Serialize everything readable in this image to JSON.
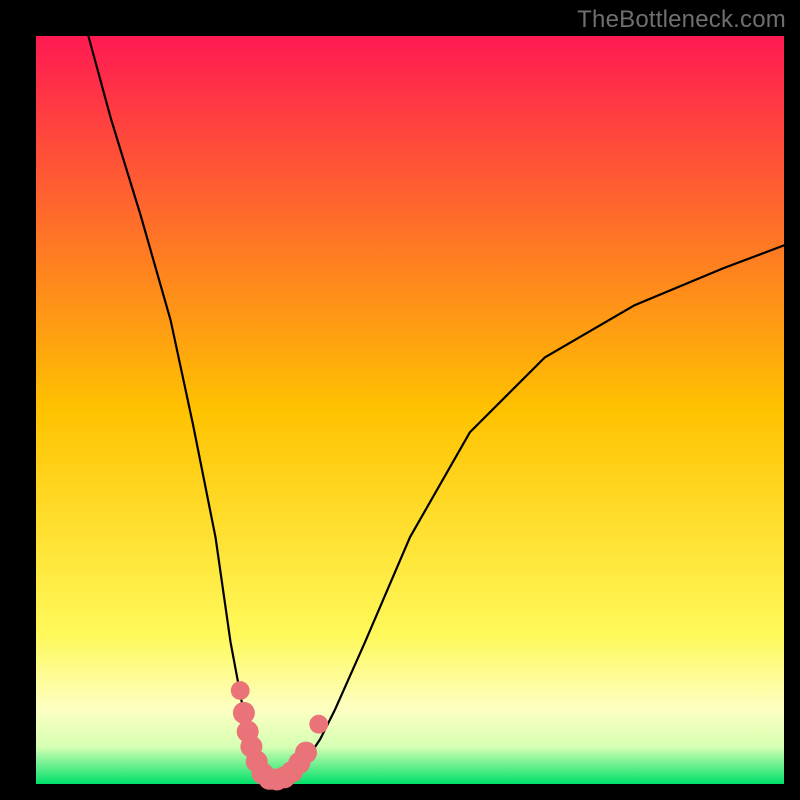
{
  "watermark": "TheBottleneck.com",
  "chart_data": {
    "type": "line",
    "title": "",
    "xlabel": "",
    "ylabel": "",
    "xlim": [
      0,
      100
    ],
    "ylim": [
      0,
      100
    ],
    "background_gradient": {
      "stops": [
        {
          "pos": 0,
          "color": "#ff1a52"
        },
        {
          "pos": 50,
          "color": "#ffc200"
        },
        {
          "pos": 80,
          "color": "#fff95a"
        },
        {
          "pos": 90,
          "color": "#fdffc2"
        },
        {
          "pos": 95,
          "color": "#d6ffb3"
        },
        {
          "pos": 100,
          "color": "#00e06a"
        }
      ]
    },
    "series": [
      {
        "name": "bottleneck-curve",
        "x": [
          7,
          10,
          14,
          18,
          21,
          24,
          26,
          27.5,
          29,
          30,
          31,
          32.5,
          34,
          36,
          38,
          40,
          44,
          50,
          58,
          68,
          80,
          92,
          100
        ],
        "y": [
          100,
          89,
          76,
          62,
          48,
          33,
          19,
          11,
          5,
          1.5,
          0.5,
          0.5,
          1.2,
          3,
          6,
          10,
          19,
          33,
          47,
          57,
          64,
          69,
          72
        ]
      }
    ],
    "markers": {
      "name": "highlight-dots",
      "color": "#ea7379",
      "points": [
        {
          "x": 27.3,
          "y": 12.5,
          "r": 1.2
        },
        {
          "x": 27.8,
          "y": 9.5,
          "r": 1.4
        },
        {
          "x": 28.3,
          "y": 7.0,
          "r": 1.4
        },
        {
          "x": 28.8,
          "y": 5.0,
          "r": 1.4
        },
        {
          "x": 29.5,
          "y": 3.0,
          "r": 1.4
        },
        {
          "x": 30.3,
          "y": 1.4,
          "r": 1.4
        },
        {
          "x": 31.2,
          "y": 0.7,
          "r": 1.4
        },
        {
          "x": 32.2,
          "y": 0.6,
          "r": 1.4
        },
        {
          "x": 33.2,
          "y": 0.9,
          "r": 1.4
        },
        {
          "x": 34.2,
          "y": 1.6,
          "r": 1.4
        },
        {
          "x": 35.2,
          "y": 2.8,
          "r": 1.4
        },
        {
          "x": 36.1,
          "y": 4.2,
          "r": 1.4
        },
        {
          "x": 37.8,
          "y": 8.0,
          "r": 1.2
        }
      ]
    }
  }
}
